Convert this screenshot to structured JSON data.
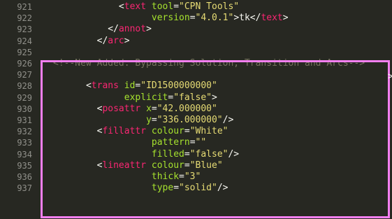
{
  "editor": {
    "lines": [
      {
        "num": "921",
        "indent": "            ",
        "tokens": [
          {
            "t": "<",
            "c": "punct"
          },
          {
            "t": "text",
            "c": "tag"
          },
          {
            "t": " ",
            "c": "punct"
          },
          {
            "t": "tool",
            "c": "attr"
          },
          {
            "t": "=",
            "c": "punct"
          },
          {
            "t": "\"CPN Tools\"",
            "c": "str"
          }
        ]
      },
      {
        "num": "922",
        "indent": "                  ",
        "tokens": [
          {
            "t": "version",
            "c": "attr"
          },
          {
            "t": "=",
            "c": "punct"
          },
          {
            "t": "\"4.0.1\"",
            "c": "str"
          },
          {
            "t": ">",
            "c": "punct"
          },
          {
            "t": "tk",
            "c": "text"
          },
          {
            "t": "</",
            "c": "punct"
          },
          {
            "t": "text",
            "c": "tag"
          },
          {
            "t": ">",
            "c": "punct"
          }
        ]
      },
      {
        "num": "923",
        "indent": "          ",
        "tokens": [
          {
            "t": "</",
            "c": "punct"
          },
          {
            "t": "annot",
            "c": "tag"
          },
          {
            "t": ">",
            "c": "punct"
          }
        ]
      },
      {
        "num": "924",
        "indent": "        ",
        "tokens": [
          {
            "t": "</",
            "c": "punct"
          },
          {
            "t": "arc",
            "c": "tag"
          },
          {
            "t": ">",
            "c": "punct"
          }
        ]
      },
      {
        "num": "925",
        "indent": "",
        "tokens": []
      },
      {
        "num": "926",
        "indent": "",
        "tokens": [
          {
            "t": "<!--New Added: Bypassing Solution, Transition and Arcs-->",
            "c": "comment"
          }
        ]
      },
      {
        "num": "927",
        "indent": "",
        "tokens": []
      },
      {
        "num": "928",
        "indent": "      ",
        "tokens": [
          {
            "t": "<",
            "c": "punct"
          },
          {
            "t": "trans",
            "c": "tag"
          },
          {
            "t": " ",
            "c": "punct"
          },
          {
            "t": "id",
            "c": "attr"
          },
          {
            "t": "=",
            "c": "punct"
          },
          {
            "t": "\"ID1500000000\"",
            "c": "str"
          }
        ]
      },
      {
        "num": "929",
        "indent": "             ",
        "tokens": [
          {
            "t": "explicit",
            "c": "attr"
          },
          {
            "t": "=",
            "c": "punct"
          },
          {
            "t": "\"false\"",
            "c": "str"
          },
          {
            "t": ">",
            "c": "punct"
          }
        ]
      },
      {
        "num": "930",
        "indent": "        ",
        "tokens": [
          {
            "t": "<",
            "c": "punct"
          },
          {
            "t": "posattr",
            "c": "tag"
          },
          {
            "t": " ",
            "c": "punct"
          },
          {
            "t": "x",
            "c": "attr"
          },
          {
            "t": "=",
            "c": "punct"
          },
          {
            "t": "\"42.000000\"",
            "c": "str"
          }
        ]
      },
      {
        "num": "931",
        "indent": "                 ",
        "tokens": [
          {
            "t": "y",
            "c": "attr"
          },
          {
            "t": "=",
            "c": "punct"
          },
          {
            "t": "\"336.000000\"",
            "c": "str"
          },
          {
            "t": "/>",
            "c": "punct"
          }
        ]
      },
      {
        "num": "932",
        "indent": "        ",
        "tokens": [
          {
            "t": "<",
            "c": "punct"
          },
          {
            "t": "fillattr",
            "c": "tag"
          },
          {
            "t": " ",
            "c": "punct"
          },
          {
            "t": "colour",
            "c": "attr"
          },
          {
            "t": "=",
            "c": "punct"
          },
          {
            "t": "\"White\"",
            "c": "str"
          }
        ]
      },
      {
        "num": "933",
        "indent": "                  ",
        "tokens": [
          {
            "t": "pattern",
            "c": "attr"
          },
          {
            "t": "=",
            "c": "punct"
          },
          {
            "t": "\"\"",
            "c": "str"
          }
        ]
      },
      {
        "num": "934",
        "indent": "                  ",
        "tokens": [
          {
            "t": "filled",
            "c": "attr"
          },
          {
            "t": "=",
            "c": "punct"
          },
          {
            "t": "\"false\"",
            "c": "str"
          },
          {
            "t": "/>",
            "c": "punct"
          }
        ]
      },
      {
        "num": "935",
        "indent": "        ",
        "tokens": [
          {
            "t": "<",
            "c": "punct"
          },
          {
            "t": "lineattr",
            "c": "tag"
          },
          {
            "t": " ",
            "c": "punct"
          },
          {
            "t": "colour",
            "c": "attr"
          },
          {
            "t": "=",
            "c": "punct"
          },
          {
            "t": "\"Blue\"",
            "c": "str"
          }
        ]
      },
      {
        "num": "936",
        "indent": "                  ",
        "tokens": [
          {
            "t": "thick",
            "c": "attr"
          },
          {
            "t": "=",
            "c": "punct"
          },
          {
            "t": "\"3\"",
            "c": "str"
          }
        ]
      },
      {
        "num": "937",
        "indent": "                  ",
        "tokens": [
          {
            "t": "type",
            "c": "attr"
          },
          {
            "t": "=",
            "c": "punct"
          },
          {
            "t": "\"solid\"",
            "c": "str"
          },
          {
            "t": "/>",
            "c": "punct"
          }
        ]
      }
    ],
    "overflow_marker": ">"
  },
  "colors": {
    "background": "#272822",
    "line_number": "#90908a",
    "tag": "#f92672",
    "attribute": "#a6e22e",
    "string": "#e6db74",
    "comment": "#75715e",
    "text": "#f8f8f2",
    "highlight_border": "#f47ff0"
  }
}
